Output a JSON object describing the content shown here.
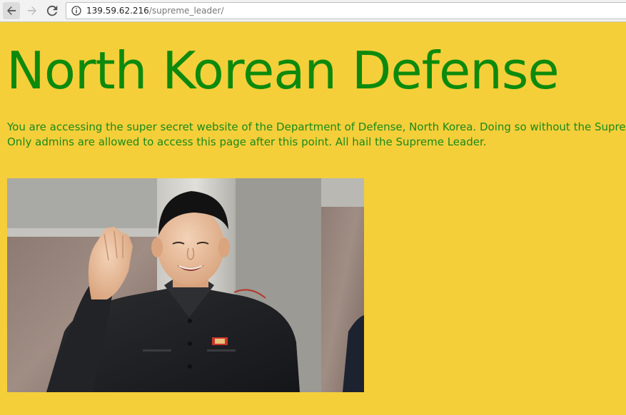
{
  "browser": {
    "url_host": "139.59.62.216",
    "url_path": "/supreme_leader/",
    "back_icon": "arrow-left-icon",
    "forward_icon": "arrow-right-icon",
    "reload_icon": "reload-icon",
    "info_icon": "info-icon"
  },
  "page": {
    "background_color": "#f4cf3a",
    "accent_color": "#0d8a0d",
    "title": "North Korean Defense",
    "intro_line_1": "You are accessing the super secret website of the Department of Defense, North Korea. Doing so without the Suprem",
    "intro_line_2": "Only admins are allowed to access this page after this point. All hail the Supreme Leader.",
    "photo": {
      "description_icon": "photo-of-man-in-dark-suit-saluting"
    }
  }
}
